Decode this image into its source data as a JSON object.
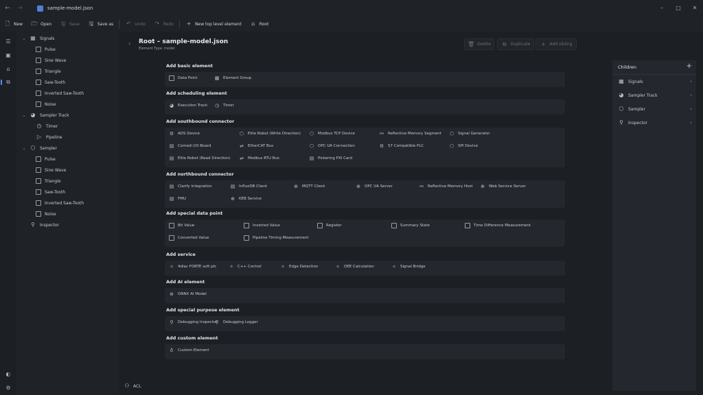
{
  "window": {
    "title": "sample-model.json"
  },
  "toolbar": [
    {
      "label": "New",
      "icon": "new-file-icon",
      "glyph": "🗋",
      "enabled": true
    },
    {
      "label": "Open",
      "icon": "open-icon",
      "glyph": "🗁",
      "enabled": true
    },
    {
      "label": "Save",
      "icon": "save-icon",
      "glyph": "🖫",
      "enabled": false
    },
    {
      "label": "Save as",
      "icon": "save-as-icon",
      "glyph": "🖫",
      "enabled": true
    },
    {
      "label": "Undo",
      "icon": "undo-icon",
      "glyph": "↶",
      "enabled": false
    },
    {
      "label": "Redo",
      "icon": "redo-icon",
      "glyph": "↷",
      "enabled": false
    },
    {
      "label": "New top level element",
      "icon": "plus-icon",
      "glyph": "+",
      "enabled": true
    },
    {
      "label": "Root",
      "icon": "home-icon",
      "glyph": "⌂",
      "enabled": true
    }
  ],
  "tree": [
    {
      "label": "Signals",
      "level": 0,
      "icon": "signals-icon",
      "glyph": "▦",
      "expanded": true
    },
    {
      "label": "Pulse",
      "level": 1,
      "icon": "checkbox-icon"
    },
    {
      "label": "Sine Wave",
      "level": 1,
      "icon": "checkbox-icon"
    },
    {
      "label": "Triangle",
      "level": 1,
      "icon": "checkbox-icon"
    },
    {
      "label": "Saw-Tooth",
      "level": 1,
      "icon": "checkbox-icon"
    },
    {
      "label": "Inverted Saw-Tooth",
      "level": 1,
      "icon": "checkbox-icon"
    },
    {
      "label": "Noise",
      "level": 1,
      "icon": "checkbox-icon"
    },
    {
      "label": "Sampler Track",
      "level": 0,
      "icon": "track-icon",
      "glyph": "◕",
      "expanded": true
    },
    {
      "label": "Timer",
      "level": 1,
      "icon": "timer-icon",
      "glyph": "◷"
    },
    {
      "label": "Pipeline",
      "level": 1,
      "icon": "play-icon",
      "glyph": "▷"
    },
    {
      "label": "Sampler",
      "level": 0,
      "icon": "cube-icon",
      "glyph": "⬡",
      "expanded": true
    },
    {
      "label": "Pulse",
      "level": 1,
      "icon": "checkbox-icon"
    },
    {
      "label": "Sine Wave",
      "level": 1,
      "icon": "checkbox-icon"
    },
    {
      "label": "Triangle",
      "level": 1,
      "icon": "checkbox-icon"
    },
    {
      "label": "Saw-Tooth",
      "level": 1,
      "icon": "checkbox-icon"
    },
    {
      "label": "Inverted Saw-Tooth",
      "level": 1,
      "icon": "checkbox-icon"
    },
    {
      "label": "Noise",
      "level": 1,
      "icon": "checkbox-icon"
    },
    {
      "label": "Inspector",
      "level": 0,
      "icon": "inspector-icon",
      "glyph": "⚲",
      "expanded": false,
      "leaf": true
    }
  ],
  "page": {
    "title": "Root – sample-model.json",
    "subtitle": "Element Type: model",
    "actions": [
      {
        "label": "Delete",
        "icon": "trash-icon",
        "glyph": "🗑"
      },
      {
        "label": "Duplicate",
        "icon": "duplicate-icon",
        "glyph": "⧉"
      },
      {
        "label": "Add sibling",
        "icon": "plus-icon",
        "glyph": "+"
      }
    ]
  },
  "sections": [
    {
      "title": "Add basic element",
      "items": [
        {
          "label": "Data Point",
          "icon": "datapoint-icon",
          "glyph": "☐"
        },
        {
          "label": "Element Group",
          "icon": "group-icon",
          "glyph": "▦"
        }
      ]
    },
    {
      "title": "Add scheduling element",
      "items": [
        {
          "label": "Execution Track",
          "icon": "track-icon",
          "glyph": "◕"
        },
        {
          "label": "Timer",
          "icon": "timer-icon",
          "glyph": "◷"
        }
      ]
    },
    {
      "title": "Add southbound connector",
      "items": [
        {
          "label": "ADS Device",
          "icon": "gear-icon",
          "glyph": "⚙"
        },
        {
          "label": "Elite Robot (Write Direction)",
          "icon": "cube-icon",
          "glyph": "⬡"
        },
        {
          "label": "Modbus TCP Device",
          "icon": "cube-icon",
          "glyph": "⬡"
        },
        {
          "label": "Reflective Memory Segment",
          "icon": "link-icon",
          "glyph": "⚯"
        },
        {
          "label": "Signal Generator",
          "icon": "cube-icon",
          "glyph": "⬡"
        },
        {
          "label": "Comedi I/O Board",
          "icon": "board-icon",
          "glyph": "▤"
        },
        {
          "label": "EtherCAT Bus",
          "icon": "bus-icon",
          "glyph": "⇌"
        },
        {
          "label": "OPC UA Connection",
          "icon": "cube-icon",
          "glyph": "⬡"
        },
        {
          "label": "S7 Compatible PLC",
          "icon": "gear-icon",
          "glyph": "⚙"
        },
        {
          "label": "SPI Device",
          "icon": "cube-icon",
          "glyph": "⬡"
        },
        {
          "label": "Elite Robot (Read Direction)",
          "icon": "board-icon",
          "glyph": "▤"
        },
        {
          "label": "Modbus RTU Bus",
          "icon": "bus-icon",
          "glyph": "⇌"
        },
        {
          "label": "Pickering PXI Card",
          "icon": "board-icon",
          "glyph": "▤"
        }
      ]
    },
    {
      "title": "Add northbound connector",
      "items": [
        {
          "label": "Clarify Integration",
          "icon": "board-icon",
          "glyph": "▤"
        },
        {
          "label": "InfluxDB Client",
          "icon": "board-icon",
          "glyph": "▤"
        },
        {
          "label": "MQTT Client",
          "icon": "globe-icon",
          "glyph": "⊕"
        },
        {
          "label": "OPC UA Server",
          "icon": "globe-icon",
          "glyph": "⊕"
        },
        {
          "label": "Reflective Memory Host",
          "icon": "link-icon",
          "glyph": "⚯"
        },
        {
          "label": "Web Service Server",
          "icon": "globe-icon",
          "glyph": "⊕"
        },
        {
          "label": "FMU",
          "icon": "board-icon",
          "glyph": "▤"
        },
        {
          "label": "KEB Service",
          "icon": "globe-icon",
          "glyph": "⊕"
        }
      ]
    },
    {
      "title": "Add special data point",
      "items": [
        {
          "label": "Bit Value",
          "icon": "checkbox-icon",
          "glyph": "☐"
        },
        {
          "label": "Inverted Value",
          "icon": "checkbox-icon",
          "glyph": "☐"
        },
        {
          "label": "Register",
          "icon": "checkbox-icon",
          "glyph": "☐"
        },
        {
          "label": "Summary State",
          "icon": "checkbox-icon",
          "glyph": "☐"
        },
        {
          "label": "Time Difference Measurement",
          "icon": "checkbox-icon",
          "glyph": "☐"
        },
        {
          "label": "Converted Value",
          "icon": "checkbox-icon",
          "glyph": "☐"
        },
        {
          "label": "Pipeline Timing Measurement",
          "icon": "checkbox-icon",
          "glyph": "☐"
        }
      ]
    },
    {
      "title": "Add service",
      "items": [
        {
          "label": "4diac FORTE soft plc",
          "icon": "wand-icon",
          "glyph": "✧"
        },
        {
          "label": "C++ Control",
          "icon": "wand-icon",
          "glyph": "✧"
        },
        {
          "label": "Edge Detection",
          "icon": "wand-icon",
          "glyph": "✧"
        },
        {
          "label": "OEE Calculation",
          "icon": "wand-icon",
          "glyph": "✧"
        },
        {
          "label": "Signal Bridge",
          "icon": "wand-icon",
          "glyph": "✧"
        }
      ]
    },
    {
      "title": "Add AI element",
      "items": [
        {
          "label": "ONNX AI Model",
          "icon": "ai-icon",
          "glyph": "⊛"
        }
      ]
    },
    {
      "title": "Add special purpose element",
      "items": [
        {
          "label": "Debugging Inspector",
          "icon": "inspector-icon",
          "glyph": "⚲"
        },
        {
          "label": "Debugging Logger",
          "icon": "inspector-icon",
          "glyph": "⚲"
        }
      ]
    },
    {
      "title": "Add custom element",
      "items": [
        {
          "label": "Custom Element",
          "icon": "bulb-icon",
          "glyph": "♁"
        }
      ]
    }
  ],
  "children": {
    "title": "Children",
    "items": [
      {
        "label": "Signals",
        "icon": "signals-icon",
        "glyph": "▦"
      },
      {
        "label": "Sampler Track",
        "icon": "track-icon",
        "glyph": "◕"
      },
      {
        "label": "Sampler",
        "icon": "cube-icon",
        "glyph": "⬡"
      },
      {
        "label": "Inspector",
        "icon": "inspector-icon",
        "glyph": "⚲"
      }
    ]
  },
  "footer": {
    "acl_label": "ACL"
  },
  "colors": {
    "background": "#1c1f24",
    "panel": "#24272d",
    "accent": "#5b8def"
  }
}
